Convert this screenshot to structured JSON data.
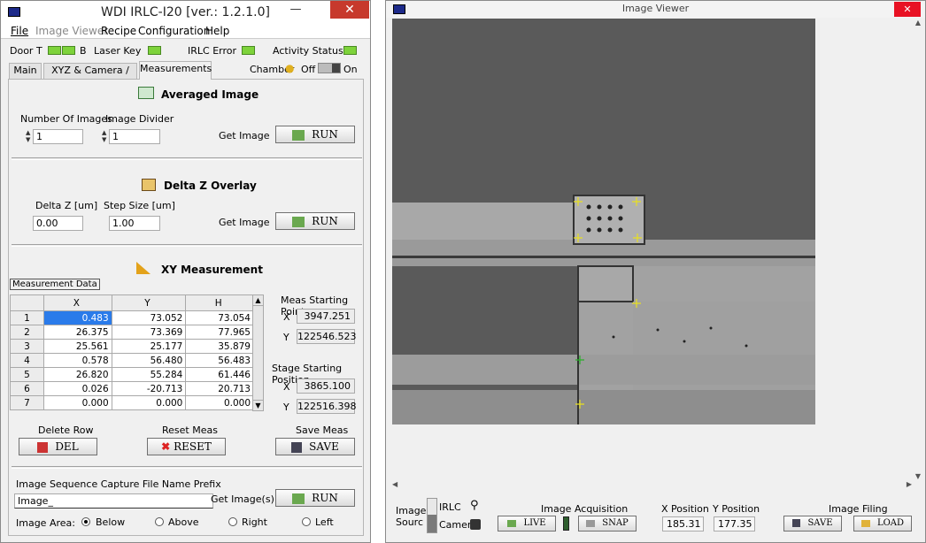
{
  "left": {
    "title": "WDI IRLC-I20 [ver.: 1.2.1.0]",
    "minimize": "—",
    "close": "✕",
    "menu": [
      "File",
      "Image Viewer",
      "Recipe",
      "Configuration",
      "Help"
    ],
    "status": {
      "door": "Door T",
      "door_b": "B",
      "laser": "Laser Key",
      "irlc_error": "IRLC Error",
      "activity": "Activity Status",
      "chamber": "Chamber",
      "off": "Off",
      "on": "On"
    },
    "tabs": [
      "Main",
      "XYZ & Camera / IRLC",
      "Measurements"
    ],
    "averaged": {
      "title": "Averaged Image",
      "num_label": "Number Of Images",
      "num_value": "1",
      "div_label": "Image Divider",
      "div_value": "1",
      "get": "Get Image",
      "run": "RUN"
    },
    "delta": {
      "title": "Delta Z Overlay",
      "dz_label": "Delta Z [um]",
      "dz_value": "0.00",
      "step_label": "Step Size [um]",
      "step_value": "1.00",
      "get": "Get Image",
      "run": "RUN"
    },
    "xy": {
      "title": "XY Measurement",
      "group": "Measurement Data",
      "headers": [
        "X",
        "Y",
        "H"
      ],
      "rows": [
        [
          "1",
          "0.483",
          "73.052",
          "73.054"
        ],
        [
          "2",
          "26.375",
          "73.369",
          "77.965"
        ],
        [
          "3",
          "25.561",
          "25.177",
          "35.879"
        ],
        [
          "4",
          "0.578",
          "56.480",
          "56.483"
        ],
        [
          "5",
          "26.820",
          "55.284",
          "61.446"
        ],
        [
          "6",
          "0.026",
          "-20.713",
          "20.713"
        ],
        [
          "7",
          "0.000",
          "0.000",
          "0.000"
        ]
      ],
      "meas_start": "Meas Starting Point",
      "meas_x": "3947.251",
      "meas_y": "122546.523",
      "stage_start": "Stage Starting Position",
      "stage_x": "3865.100",
      "stage_y": "122516.398",
      "x": "X",
      "y": "Y",
      "delete_row": "Delete Row",
      "del": "DEL",
      "reset_meas": "Reset Meas",
      "reset": "RESET",
      "save_meas": "Save Meas",
      "save": "SAVE"
    },
    "seq": {
      "label": "Image Sequence Capture File Name Prefix",
      "value": "Image_",
      "get": "Get Image(s)",
      "run": "RUN",
      "area": "Image Area:",
      "below": "Below",
      "above": "Above",
      "right": "Right",
      "left": "Left"
    }
  },
  "right": {
    "title": "Image Viewer",
    "close": "✕",
    "source_label1": "Image",
    "source_label2": "Sourc",
    "irlc": "IRLC",
    "camera": "Camera",
    "acq_title": "Image Acquisition",
    "live": "LIVE",
    "snap": "SNAP",
    "xpos_label": "X Position",
    "xpos": "185.31",
    "ypos_label": "Y Position",
    "ypos": "177.35",
    "filing_title": "Image Filing",
    "save": "SAVE",
    "load": "LOAD"
  }
}
